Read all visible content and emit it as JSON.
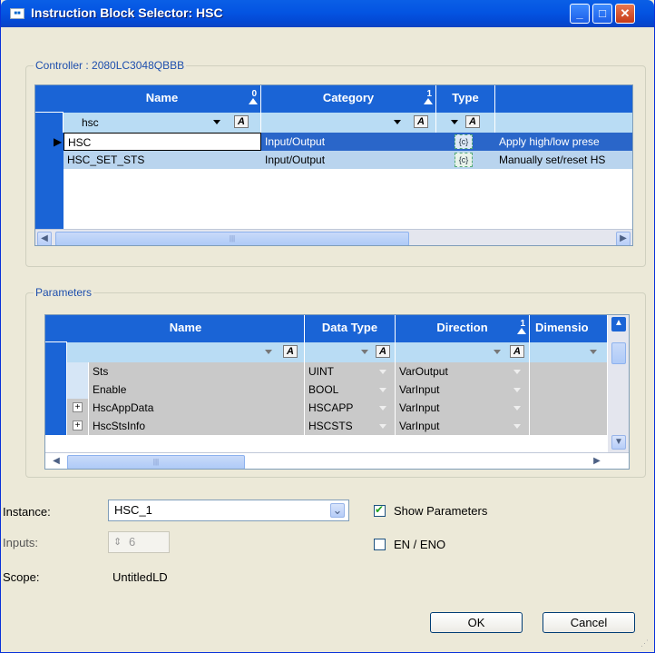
{
  "window": {
    "title": "Instruction Block Selector: HSC",
    "icon": "window-app-icon"
  },
  "controller_group": {
    "caption": "Controller : 2080LC3048QBBB"
  },
  "instructions": {
    "headers": {
      "name": "Name",
      "name_order": "0",
      "category": "Category",
      "category_order": "1",
      "type": "Type"
    },
    "filter": {
      "name": "hsc"
    },
    "rows": [
      {
        "name": "HSC",
        "category": "Input/Output",
        "description": "Apply high/low prese"
      },
      {
        "name": "HSC_SET_STS",
        "category": "Input/Output",
        "description": "Manually set/reset HS"
      }
    ]
  },
  "parameters_group": {
    "caption": "Parameters"
  },
  "parameters": {
    "headers": {
      "name": "Name",
      "data_type": "Data Type",
      "direction": "Direction",
      "direction_order": "1",
      "dimension": "Dimensio"
    },
    "rows": [
      {
        "expand": "",
        "name": "Sts",
        "data_type": "UINT",
        "direction": "VarOutput"
      },
      {
        "expand": "",
        "name": "Enable",
        "data_type": "BOOL",
        "direction": "VarInput"
      },
      {
        "expand": "+",
        "name": "HscAppData",
        "data_type": "HSCAPP",
        "direction": "VarInput"
      },
      {
        "expand": "+",
        "name": "HscStsInfo",
        "data_type": "HSCSTS",
        "direction": "VarInput"
      }
    ]
  },
  "form": {
    "instance_label": "Instance:",
    "instance_value": "HSC_1",
    "inputs_label": "Inputs:",
    "inputs_value": "6",
    "scope_label": "Scope:",
    "scope_value": "UntitledLD",
    "show_parameters_label": "Show Parameters",
    "show_parameters_checked": true,
    "en_eno_label": "EN / ENO",
    "en_eno_checked": false
  },
  "buttons": {
    "ok": "OK",
    "cancel": "Cancel"
  },
  "glyphs": {
    "minimize": "_",
    "maximize": "□",
    "close": "✕",
    "check": "✔",
    "chevron": "⌄",
    "arrow_left": "◀",
    "arrow_right": "▶",
    "spin": "⇕",
    "row_pointer": "▶",
    "fa": "A",
    "scroll_grip": "|||"
  },
  "colors": {
    "titlebar": "#0454e2",
    "header_blue": "#1a64d6",
    "filter_row": "#b9dcf4",
    "selected_row": "#2a66c9"
  }
}
